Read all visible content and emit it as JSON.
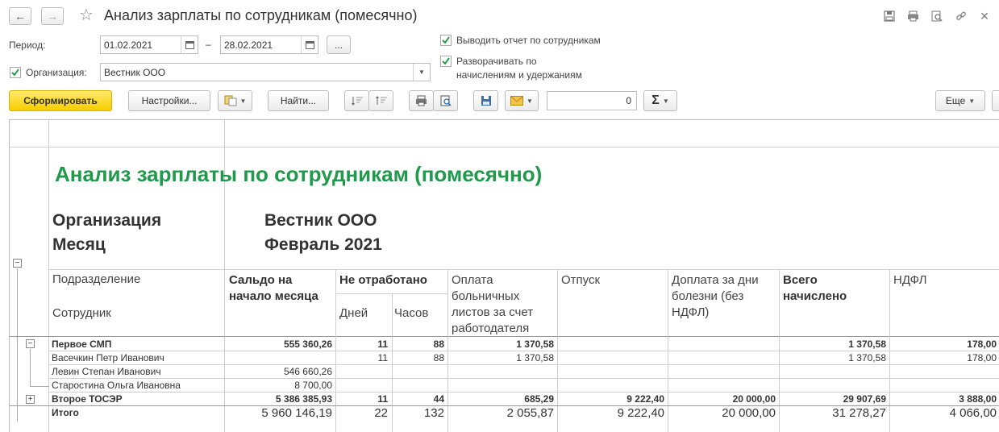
{
  "window": {
    "title": "Анализ зарплаты по сотрудникам (помесячно)"
  },
  "form": {
    "period_label": "Период:",
    "date_from": "01.02.2021",
    "date_dash": "–",
    "date_to": "28.02.2021",
    "more_btn": "...",
    "org_label": "Организация:",
    "org_value": "Вестник ООО",
    "cb_by_employees": "Выводить отчет по сотрудникам",
    "cb_expand_line1": "Разворачивать по",
    "cb_expand_line2": "начислениям и удержаниям"
  },
  "toolbar": {
    "generate": "Сформировать",
    "settings": "Настройки...",
    "find": "Найти...",
    "number_value": "0",
    "more": "Еще"
  },
  "report": {
    "title": "Анализ зарплаты по сотрудникам (помесячно)",
    "org_label": "Организация",
    "org_value": "Вестник ООО",
    "month_label": "Месяц",
    "month_value": "Февраль 2021",
    "col_division": "Подразделение",
    "col_employee": "Сотрудник",
    "col_balance_l1": "Сальдо на",
    "col_balance_l2": "начало месяца",
    "col_not_worked": "Не отработано",
    "col_days": "Дней",
    "col_hours": "Часов",
    "col_sick_l1": "Оплата",
    "col_sick_l2": "больничных",
    "col_sick_l3": "листов за счет",
    "col_sick_l4": "работодателя",
    "col_vacation": "Отпуск",
    "col_extra_l1": "Доплата за дни",
    "col_extra_l2": "болезни (без",
    "col_extra_l3": "НДФЛ)",
    "col_total_l1": "Всего",
    "col_total_l2": "начислено",
    "col_ndfl": "НДФЛ",
    "rows": [
      {
        "name": "Первое СМП",
        "balance": "555 360,26",
        "days": "11",
        "hours": "88",
        "sick": "1 370,58",
        "vacation": "",
        "extra": "",
        "total": "1 370,58",
        "ndfl": "178,00"
      },
      {
        "name": "Васечкин Петр Иванович",
        "balance": "",
        "days": "11",
        "hours": "88",
        "sick": "1 370,58",
        "vacation": "",
        "extra": "",
        "total": "1 370,58",
        "ndfl": "178,00"
      },
      {
        "name": "Левин Степан Иванович",
        "balance": "546 660,26",
        "days": "",
        "hours": "",
        "sick": "",
        "vacation": "",
        "extra": "",
        "total": "",
        "ndfl": ""
      },
      {
        "name": "Старостина Ольга Ивановна",
        "balance": "8 700,00",
        "days": "",
        "hours": "",
        "sick": "",
        "vacation": "",
        "extra": "",
        "total": "",
        "ndfl": ""
      },
      {
        "name": "Второе ТОСЭР",
        "balance": "5 386 385,93",
        "days": "11",
        "hours": "44",
        "sick": "685,29",
        "vacation": "9 222,40",
        "extra": "20 000,00",
        "total": "29 907,69",
        "ndfl": "3 888,00"
      },
      {
        "name": "Итого",
        "balance": "5 960 146,19",
        "days": "22",
        "hours": "132",
        "sick": "2 055,87",
        "vacation": "9 222,40",
        "extra": "20 000,00",
        "total": "31 278,27",
        "ndfl": "4 066,00"
      }
    ]
  }
}
